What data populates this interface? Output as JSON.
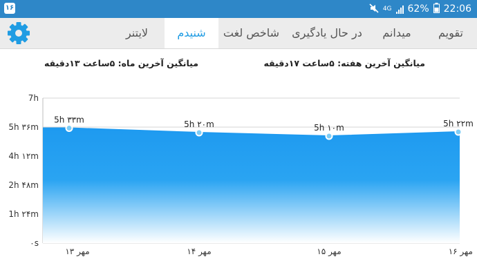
{
  "status_bar": {
    "left_badge": "۱۶",
    "mute_icon": "mute-icon",
    "network": "4G",
    "battery_percent": "62%",
    "time": "22:06"
  },
  "tabs": [
    {
      "label": "تقویم",
      "active": false
    },
    {
      "label": "میدانم",
      "active": false
    },
    {
      "label": "در حال یادگیری",
      "active": false
    },
    {
      "label": "شاخص لغت",
      "active": false
    },
    {
      "label": "شنیدم",
      "active": true
    },
    {
      "label": "لایتنر",
      "active": false
    }
  ],
  "settings_icon": "gear-icon",
  "averages": {
    "week": "میانگین آخرین هفته: ۵ساعت  ۱۷دقیقه",
    "month": "میانگین آخرین ماه: ۵ساعت  ۱۳دقیقه"
  },
  "colors": {
    "status_bar": "#2e87c8",
    "accent": "#1f9ce3",
    "area_top": "#1e9af0",
    "area_bottom": "#ffffff"
  },
  "chart_data": {
    "type": "area",
    "x": [
      "۱۳ مهر",
      "۱۴ مهر",
      "۱۵ مهر",
      "۱۶ مهر"
    ],
    "values_minutes": [
      333,
      320,
      310,
      322
    ],
    "data_labels": [
      "5h ۳۳m",
      "5h ۲۰m",
      "5h ۱۰m",
      "5h ۲۲m"
    ],
    "y_ticks": [
      "۰s",
      "1h ۲۴m",
      "2h ۴۸m",
      "4h ۱۲m",
      "5h ۳۶m",
      "7h"
    ],
    "ylim_minutes": [
      0,
      420
    ],
    "grid": true
  }
}
